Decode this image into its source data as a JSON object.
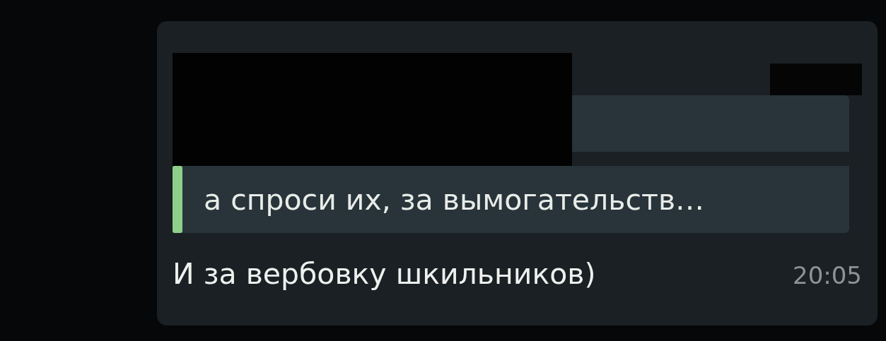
{
  "message": {
    "reply_quote": {
      "text": "а спроси их, за вымогательств…"
    },
    "text": "И за вербовку шкильников)",
    "time": "20:05"
  }
}
